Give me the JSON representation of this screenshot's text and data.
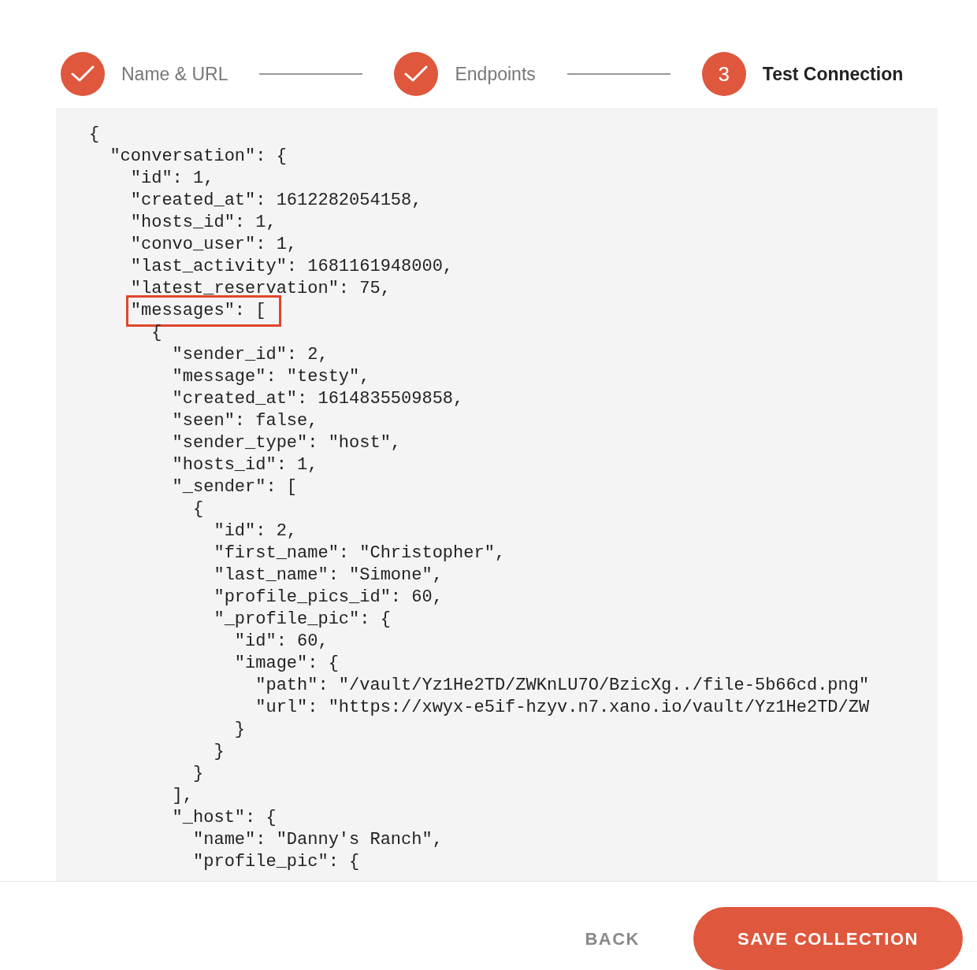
{
  "steps": [
    {
      "label": "Name & URL",
      "done": true
    },
    {
      "label": "Endpoints",
      "done": true
    },
    {
      "label": "Test Connection",
      "done": false,
      "number": "3"
    }
  ],
  "code_lines": [
    {
      "text": "{",
      "highlighted": false
    },
    {
      "text": "  \"conversation\": {",
      "highlighted": false
    },
    {
      "text": "    \"id\": 1,",
      "highlighted": false
    },
    {
      "text": "    \"created_at\": 1612282054158,",
      "highlighted": false
    },
    {
      "text": "    \"hosts_id\": 1,",
      "highlighted": false
    },
    {
      "text": "    \"convo_user\": 1,",
      "highlighted": false
    },
    {
      "text": "    \"last_activity\": 1681161948000,",
      "highlighted": false
    },
    {
      "text": "    \"latest_reservation\": 75,",
      "highlighted": false
    },
    {
      "text": "    \"messages\": [",
      "highlighted": true
    },
    {
      "text": "      {",
      "highlighted": false
    },
    {
      "text": "        \"sender_id\": 2,",
      "highlighted": false
    },
    {
      "text": "        \"message\": \"testy\",",
      "highlighted": false
    },
    {
      "text": "        \"created_at\": 1614835509858,",
      "highlighted": false
    },
    {
      "text": "        \"seen\": false,",
      "highlighted": false
    },
    {
      "text": "        \"sender_type\": \"host\",",
      "highlighted": false
    },
    {
      "text": "        \"hosts_id\": 1,",
      "highlighted": false
    },
    {
      "text": "        \"_sender\": [",
      "highlighted": false
    },
    {
      "text": "          {",
      "highlighted": false
    },
    {
      "text": "            \"id\": 2,",
      "highlighted": false
    },
    {
      "text": "            \"first_name\": \"Christopher\",",
      "highlighted": false
    },
    {
      "text": "            \"last_name\": \"Simone\",",
      "highlighted": false
    },
    {
      "text": "            \"profile_pics_id\": 60,",
      "highlighted": false
    },
    {
      "text": "            \"_profile_pic\": {",
      "highlighted": false
    },
    {
      "text": "              \"id\": 60,",
      "highlighted": false
    },
    {
      "text": "              \"image\": {",
      "highlighted": false
    },
    {
      "text": "                \"path\": \"/vault/Yz1He2TD/ZWKnLU7O/BzicXg../file-5b66cd.png\"",
      "highlighted": false
    },
    {
      "text": "                \"url\": \"https://xwyx-e5if-hzyv.n7.xano.io/vault/Yz1He2TD/ZW",
      "highlighted": false
    },
    {
      "text": "              }",
      "highlighted": false
    },
    {
      "text": "            }",
      "highlighted": false
    },
    {
      "text": "          }",
      "highlighted": false
    },
    {
      "text": "        ],",
      "highlighted": false
    },
    {
      "text": "        \"_host\": {",
      "highlighted": false
    },
    {
      "text": "          \"name\": \"Danny's Ranch\",",
      "highlighted": false
    },
    {
      "text": "          \"profile_pic\": {",
      "highlighted": false
    }
  ],
  "buttons": {
    "back": "BACK",
    "save": "SAVE COLLECTION"
  }
}
